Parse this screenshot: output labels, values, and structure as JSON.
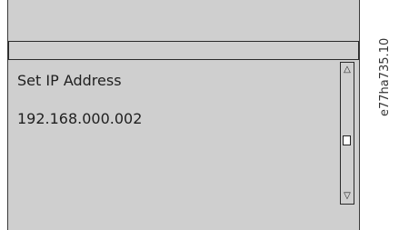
{
  "screen": {
    "title": "",
    "parameter_label": "Set IP Address",
    "parameter_value": "192.168.000.002"
  },
  "scrollbar": {
    "up_icon": "triangle-up-icon",
    "down_icon": "triangle-down-icon",
    "up_glyph": "△",
    "down_glyph": "▽"
  },
  "figure": {
    "code": "e77ha735.10"
  }
}
